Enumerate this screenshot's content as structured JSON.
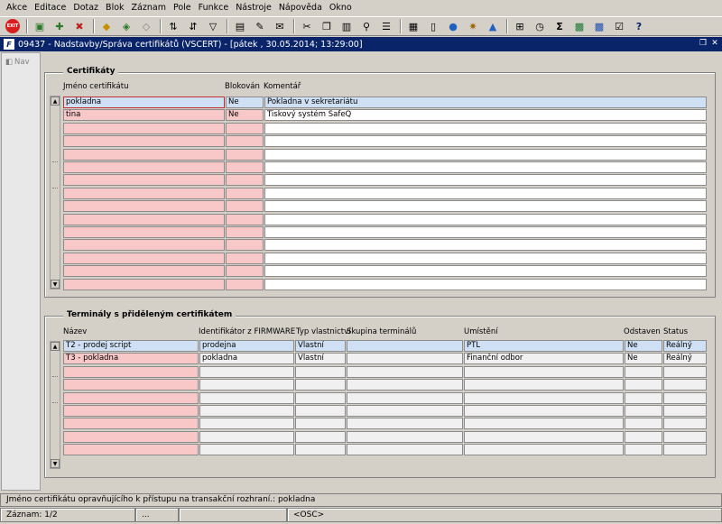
{
  "menu": [
    "Akce",
    "Editace",
    "Dotaz",
    "Blok",
    "Záznam",
    "Pole",
    "Funkce",
    "Nástroje",
    "Nápověda",
    "Okno"
  ],
  "toolbar": {
    "exit_label": "EXIT",
    "icons": [
      "save-icon",
      "new-record-icon",
      "delete-record-icon",
      "query-icon",
      "execute-query-icon",
      "cancel-query-icon",
      "sort-icon",
      "filter-icon",
      "print-icon",
      "edit-icon",
      "mail-icon",
      "cut-icon",
      "copy-icon",
      "paste-icon",
      "search-icon",
      "warning-icon",
      "calculator-icon",
      "tree-icon",
      "chart-icon",
      "excel-icon",
      "word-icon",
      "sum-icon",
      "checklist-icon",
      "help-icon"
    ],
    "sum_glyph": "Σ",
    "help_glyph": "?"
  },
  "window": {
    "title": "09437 - Nadstavby/Správa certifikátů (VSCERT) - [pátek , 30.05.2014; 13:29:00]",
    "logo": "F"
  },
  "nav": {
    "label": "Nav"
  },
  "certificates": {
    "section_title": "Certifikáty",
    "headers": {
      "name": "Jméno certifikátu",
      "blocked": "Blokován",
      "comment": "Komentář"
    },
    "rows": [
      {
        "name": "pokladna",
        "blocked": "Ne",
        "comment": "Pokladna v sekretariátu"
      },
      {
        "name": "tina",
        "blocked": "Ne",
        "comment": "Tiskový systém SafeQ"
      }
    ],
    "empty_rows": 13
  },
  "terminals": {
    "section_title": "Terminály s přiděleným certifikátem",
    "headers": {
      "name": "Název",
      "firmware": "Identifikátor z FIRMWARE",
      "ownership": "Typ vlastnictví",
      "group": "Skupina terminálů",
      "location": "Umístění",
      "removed": "Odstaven",
      "status": "Status"
    },
    "rows": [
      {
        "name": "T2 - prodej script",
        "firmware": "prodejna",
        "ownership": "Vlastní",
        "group": "",
        "location": "PTL",
        "removed": "Ne",
        "status": "Reálný"
      },
      {
        "name": "T3 - pokladna",
        "firmware": "pokladna",
        "ownership": "Vlastní",
        "group": "",
        "location": "Finanční odbor",
        "removed": "Ne",
        "status": "Reálný"
      }
    ],
    "empty_rows": 7
  },
  "status": {
    "message": "Jméno certifikátu opravňujícího k přístupu na transakční rozhraní.: pokladna",
    "record": "Záznam: 1/2",
    "pane2": "...",
    "pane3": "",
    "osc": "<OSC>"
  }
}
